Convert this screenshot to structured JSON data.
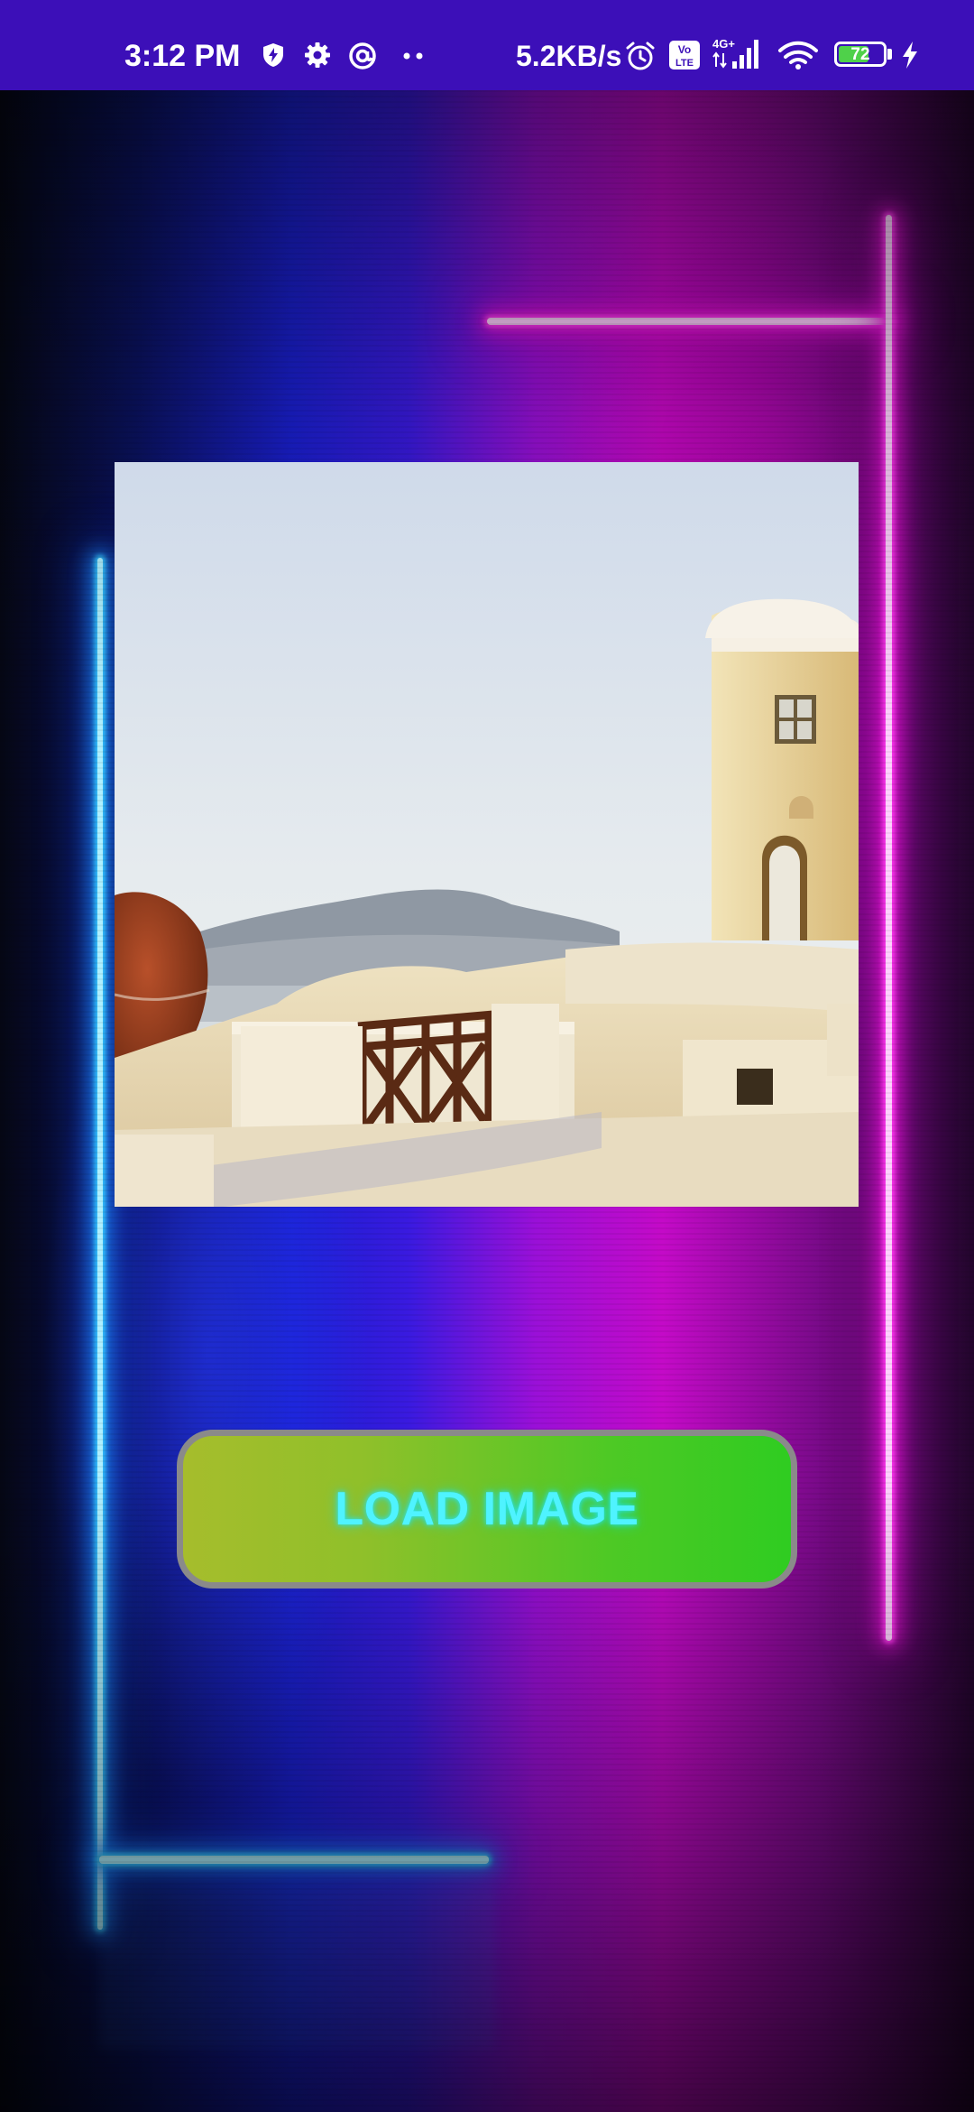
{
  "status_bar": {
    "time": "3:12 PM",
    "network_speed": "5.2KB/s",
    "battery_level": "72",
    "battery_fraction": 0.72,
    "icons": [
      "shield-bolt-icon",
      "gear-icon",
      "at-sign-icon",
      "more-dots-icon",
      "alarm-icon",
      "volte-icon",
      "signal-4g-icon",
      "wifi-icon",
      "battery-icon",
      "charging-bolt-icon"
    ],
    "signal_label": "4G+",
    "volte_label": "Vo LTE"
  },
  "main": {
    "image_icon": "santorini-photo",
    "load_button_label": "LOAD IMAGE"
  },
  "colors": {
    "status_bar": "#3c0fb8",
    "button_start": "#a6bd2c",
    "button_end": "#2fcc21",
    "button_text": "#4ff3ff",
    "neon_blue": "#35c8ff",
    "neon_pink": "#ff3cf0"
  }
}
